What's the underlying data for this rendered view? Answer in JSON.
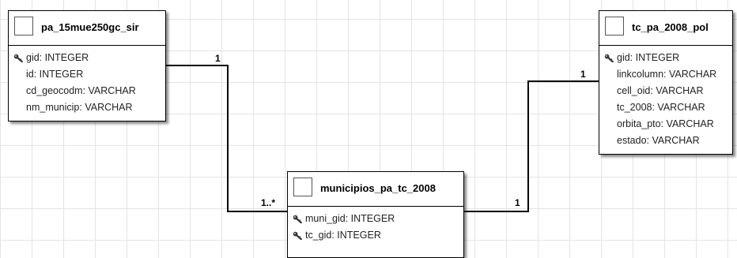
{
  "tables": [
    {
      "id": "pa",
      "title": "pa_15mue250gc_sir",
      "columns": [
        {
          "text": "gid: INTEGER",
          "icon": "key-icon"
        },
        {
          "text": "id: INTEGER",
          "icon": ""
        },
        {
          "text": "cd_geocodm: VARCHAR",
          "icon": ""
        },
        {
          "text": "nm_municip: VARCHAR",
          "icon": ""
        }
      ]
    },
    {
      "id": "tc",
      "title": "tc_pa_2008_pol",
      "columns": [
        {
          "text": "gid: INTEGER",
          "icon": "key-icon"
        },
        {
          "text": "linkcolumn: VARCHAR",
          "icon": ""
        },
        {
          "text": "cell_oid: VARCHAR",
          "icon": ""
        },
        {
          "text": "tc_2008: VARCHAR",
          "icon": ""
        },
        {
          "text": "orbita_pto: VARCHAR",
          "icon": ""
        },
        {
          "text": "estado: VARCHAR",
          "icon": ""
        }
      ]
    },
    {
      "id": "mun",
      "title": "municipios_pa_tc_2008",
      "columns": [
        {
          "text": "muni_gid: INTEGER",
          "icon": "key-icon"
        },
        {
          "text": "tc_gid: INTEGER",
          "icon": "key-icon"
        }
      ]
    }
  ],
  "relations": [
    {
      "from": "pa_15mue250gc_sir",
      "to": "municipios_pa_tc_2008",
      "from_cardinality": "1",
      "to_cardinality": "1..*"
    },
    {
      "from": "municipios_pa_tc_2008",
      "to": "tc_pa_2008_pol",
      "from_cardinality": "1",
      "to_cardinality": "1"
    }
  ],
  "colors": {
    "grid": "#e4e4e4",
    "line": "#000000",
    "table_border": "#000000",
    "background": "#ffffff"
  }
}
